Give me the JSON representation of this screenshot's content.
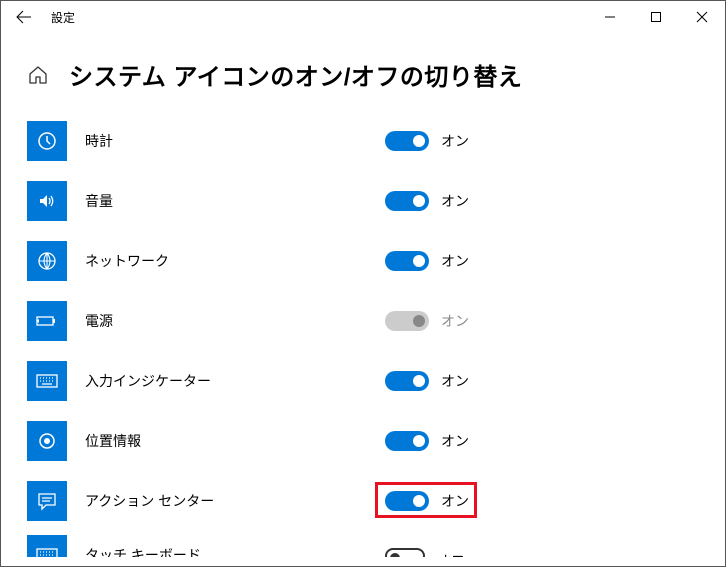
{
  "window": {
    "title": "設定"
  },
  "page": {
    "title": "システム アイコンのオン/オフの切り替え"
  },
  "labels": {
    "on": "オン",
    "off": "オフ"
  },
  "items": [
    {
      "id": "clock",
      "icon": "clock-icon",
      "label": "時計",
      "on": true,
      "disabled": false
    },
    {
      "id": "volume",
      "icon": "volume-icon",
      "label": "音量",
      "on": true,
      "disabled": false
    },
    {
      "id": "network",
      "icon": "globe-icon",
      "label": "ネットワーク",
      "on": true,
      "disabled": false
    },
    {
      "id": "power",
      "icon": "battery-icon",
      "label": "電源",
      "on": true,
      "disabled": true
    },
    {
      "id": "ime",
      "icon": "keyboard-icon",
      "label": "入力インジケーター",
      "on": true,
      "disabled": false
    },
    {
      "id": "location",
      "icon": "target-icon",
      "label": "位置情報",
      "on": true,
      "disabled": false
    },
    {
      "id": "action",
      "icon": "message-icon",
      "label": "アクション センター",
      "on": true,
      "disabled": false,
      "highlight": true
    },
    {
      "id": "touchkb",
      "icon": "keyboard-icon",
      "label": "タッチ キーボード",
      "on": false,
      "disabled": false,
      "partial": true
    }
  ],
  "colors": {
    "accent": "#0078d7",
    "highlight": "#e81123"
  }
}
